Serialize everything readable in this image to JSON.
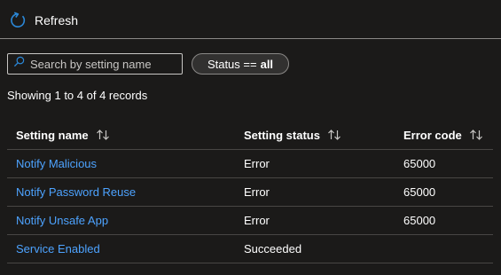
{
  "toolbar": {
    "refresh_label": "Refresh",
    "refresh_icon": "refresh-icon"
  },
  "search": {
    "placeholder": "Search by setting name",
    "value": "",
    "icon": "search-icon"
  },
  "filter": {
    "label": "Status ==",
    "value": "all"
  },
  "records_summary": "Showing 1 to 4 of 4 records",
  "table": {
    "columns": [
      "Setting name",
      "Setting status",
      "Error code"
    ],
    "rows": [
      {
        "name": "Notify Malicious",
        "status": "Error",
        "code": "65000"
      },
      {
        "name": "Notify Password Reuse",
        "status": "Error",
        "code": "65000"
      },
      {
        "name": "Notify Unsafe App",
        "status": "Error",
        "code": "65000"
      },
      {
        "name": "Service Enabled",
        "status": "Succeeded",
        "code": ""
      }
    ]
  },
  "colors": {
    "background": "#1b1a19",
    "link": "#4da3ff",
    "accent": "#0078d4"
  }
}
